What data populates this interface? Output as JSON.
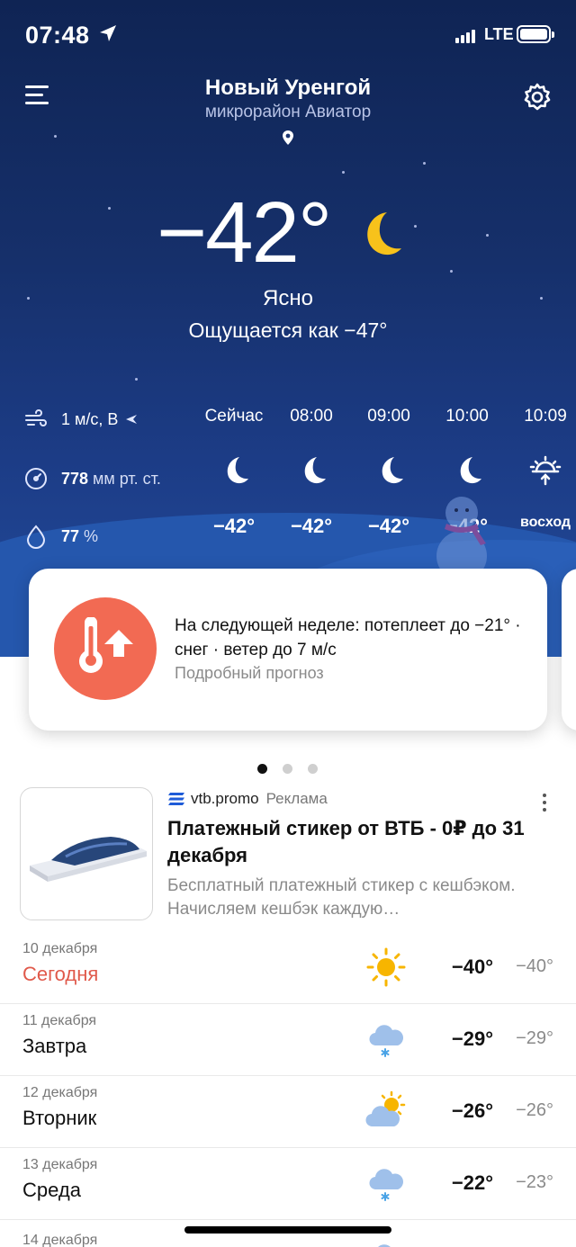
{
  "status_bar": {
    "time": "07:48",
    "network": "LTE"
  },
  "header": {
    "city": "Новый Уренгой",
    "district": "микрорайон Авиатор"
  },
  "current": {
    "temperature": "−42°",
    "condition": "Ясно",
    "feels_like": "Ощущается как −47°",
    "icon": "moon-icon"
  },
  "stats": {
    "wind": {
      "value": "1 м/с, В",
      "icon": "wind-icon"
    },
    "pressure": {
      "value": "778",
      "unit": "мм рт. ст.",
      "icon": "pressure-icon"
    },
    "humidity": {
      "value": "77",
      "unit": "%",
      "icon": "humidity-icon"
    }
  },
  "hourly": [
    {
      "label": "Сейчас",
      "temp": "−42°",
      "icon": "moon-icon"
    },
    {
      "label": "08:00",
      "temp": "−42°",
      "icon": "moon-icon"
    },
    {
      "label": "09:00",
      "temp": "−42°",
      "icon": "moon-icon"
    },
    {
      "label": "10:00",
      "temp": "−42°",
      "icon": "moon-icon"
    },
    {
      "label": "10:09",
      "temp": "восход",
      "icon": "sunrise-icon"
    }
  ],
  "alert_card": {
    "message": "На следующей неделе: потеплеет до −21° · снег · ветер до 7 м/с",
    "link": "Подробный прогноз",
    "icon": "thermometer-up-icon",
    "accent": "#f26a53"
  },
  "pager": {
    "count": 3,
    "active": 0
  },
  "ad": {
    "source": "vtb.promo",
    "label": "Реклама",
    "title": "Платежный стикер от ВТБ - 0₽ до 31 декабря",
    "description": "Бесплатный платежный стикер с кешбэком. Начисляем кешбэк каждую…"
  },
  "daily": [
    {
      "date": "10 декабря",
      "name": "Сегодня",
      "max": "−40°",
      "min": "−40°",
      "icon": "sun-icon",
      "today": true
    },
    {
      "date": "11 декабря",
      "name": "Завтра",
      "max": "−29°",
      "min": "−29°",
      "icon": "cloud-snow-icon"
    },
    {
      "date": "12 декабря",
      "name": "Вторник",
      "max": "−26°",
      "min": "−26°",
      "icon": "sun-cloud-icon"
    },
    {
      "date": "13 декабря",
      "name": "Среда",
      "max": "−22°",
      "min": "−23°",
      "icon": "cloud-snow-icon"
    },
    {
      "date": "14 декабря",
      "name": "",
      "max": "",
      "min": "",
      "icon": "cloud-snow-icon"
    }
  ],
  "colors": {
    "sky_top": "#0f2454",
    "sky_bottom": "#234b9c",
    "today": "#e0594a",
    "sun": "#f7b500"
  }
}
